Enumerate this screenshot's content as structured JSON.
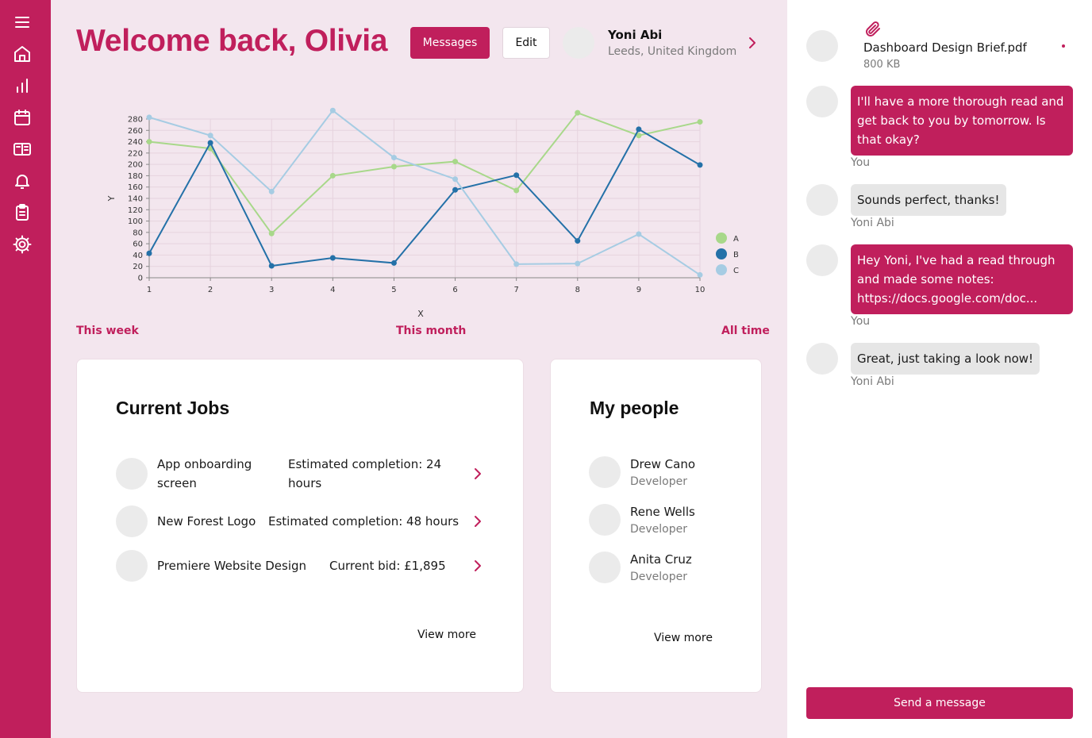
{
  "sidebar": {
    "items": [
      {
        "name": "menu"
      },
      {
        "name": "home"
      },
      {
        "name": "analytics"
      },
      {
        "name": "calendar"
      },
      {
        "name": "reader"
      },
      {
        "name": "notifications"
      },
      {
        "name": "clipboard"
      },
      {
        "name": "settings"
      }
    ]
  },
  "header": {
    "title": "Welcome back, Olivia",
    "messages_label": "Messages",
    "edit_label": "Edit",
    "profile": {
      "name": "Yoni Abi",
      "location": "Leeds, United Kingdom"
    }
  },
  "periods": [
    "This week",
    "This month",
    "All time"
  ],
  "chart_data": {
    "type": "line",
    "xlabel": "X",
    "ylabel": "Y",
    "x": [
      1,
      2,
      3,
      4,
      5,
      6,
      7,
      8,
      9,
      10
    ],
    "xlim": [
      1,
      10
    ],
    "ylim": [
      0,
      280
    ],
    "yticks": [
      0,
      20,
      40,
      60,
      80,
      100,
      120,
      140,
      160,
      180,
      200,
      220,
      240,
      260,
      280
    ],
    "grid": true,
    "legend_position": "right",
    "series": [
      {
        "name": "A",
        "color": "#a8d88a",
        "values": [
          240,
          228,
          78,
          180,
          196,
          205,
          154,
          291,
          251,
          275
        ]
      },
      {
        "name": "B",
        "color": "#2471a8",
        "values": [
          43,
          238,
          21,
          35,
          26,
          155,
          181,
          65,
          262,
          199
        ]
      },
      {
        "name": "C",
        "color": "#a6cce3",
        "values": [
          283,
          251,
          152,
          295,
          212,
          174,
          24,
          25,
          77,
          5
        ]
      }
    ]
  },
  "jobs": {
    "title": "Current Jobs",
    "items": [
      {
        "name": "App onboarding screen",
        "status": "Estimated completion: 24 hours"
      },
      {
        "name": "New Forest Logo",
        "status": "Estimated completion: 48 hours"
      },
      {
        "name": "Premiere Website Design",
        "status": "Current bid: £1,895"
      }
    ],
    "view_more": "View more"
  },
  "people": {
    "title": "My people",
    "items": [
      {
        "name": "Drew Cano",
        "role": "Developer"
      },
      {
        "name": "Rene Wells",
        "role": "Developer"
      },
      {
        "name": "Anita Cruz",
        "role": "Developer"
      }
    ],
    "view_more": "View more"
  },
  "messages": {
    "attachment": {
      "file_name": "Dashboard Design Brief.pdf",
      "size": "800 KB"
    },
    "items": [
      {
        "text": "I'll have a more thorough read and get back to you by tomorrow. Is that okay?",
        "sender": "You"
      },
      {
        "text": "Sounds perfect, thanks!",
        "sender": "Yoni Abi"
      },
      {
        "text": "Hey Yoni, I've had a read through and made some notes: https://docs.google.com/doc...",
        "sender": "You"
      },
      {
        "text": "Great, just taking a look now!",
        "sender": "Yoni Abi"
      }
    ],
    "send_label": "Send a message"
  },
  "colors": {
    "accent": "#c01f5c",
    "background": "#f3e6ee",
    "panel": "#ffffff"
  }
}
